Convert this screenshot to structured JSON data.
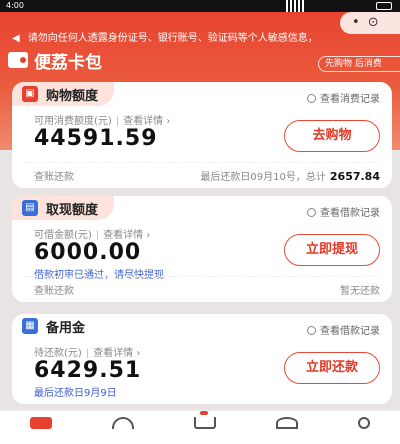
{
  "status_bar": {
    "time": "4:00"
  },
  "capsule": {
    "label": "• ⊙"
  },
  "notice": {
    "icon": "speaker-icon",
    "text": "请勿向任何人透露身份证号、银行账号、验证码等个人敏感信息，"
  },
  "brand": {
    "name": "便荔卡包",
    "icon": "wallet-icon"
  },
  "top_right": {
    "label": "先购物 后消费"
  },
  "cards": {
    "shopping": {
      "title": "购物额度",
      "record": "查看消费记录",
      "label": "可用消费额度(元)",
      "detail": "查看详情",
      "amount": "44591.59",
      "button": "去购物",
      "footer_left": "查账还款",
      "footer_right": "最后还款日09月10号，总计",
      "footer_total": "2657.84"
    },
    "cash": {
      "title": "取现额度",
      "record": "查看借款记录",
      "label": "可借金额(元)",
      "detail": "查看详情",
      "amount": "6000.00",
      "hint": "借款初审已通过，请尽快提现",
      "button": "立即提现",
      "footer_left": "查账还款",
      "footer_right": "暂无还款"
    },
    "reserve": {
      "title": "备用金",
      "record": "查看借款记录",
      "label": "待还款(元)",
      "detail": "查看详情",
      "amount": "6429.51",
      "hint": "最后还款日9月9日",
      "button": "立即还款"
    }
  },
  "colors": {
    "accent": "#e8402f",
    "link": "#3b5fd0",
    "tab_bg": "#fde3db"
  }
}
